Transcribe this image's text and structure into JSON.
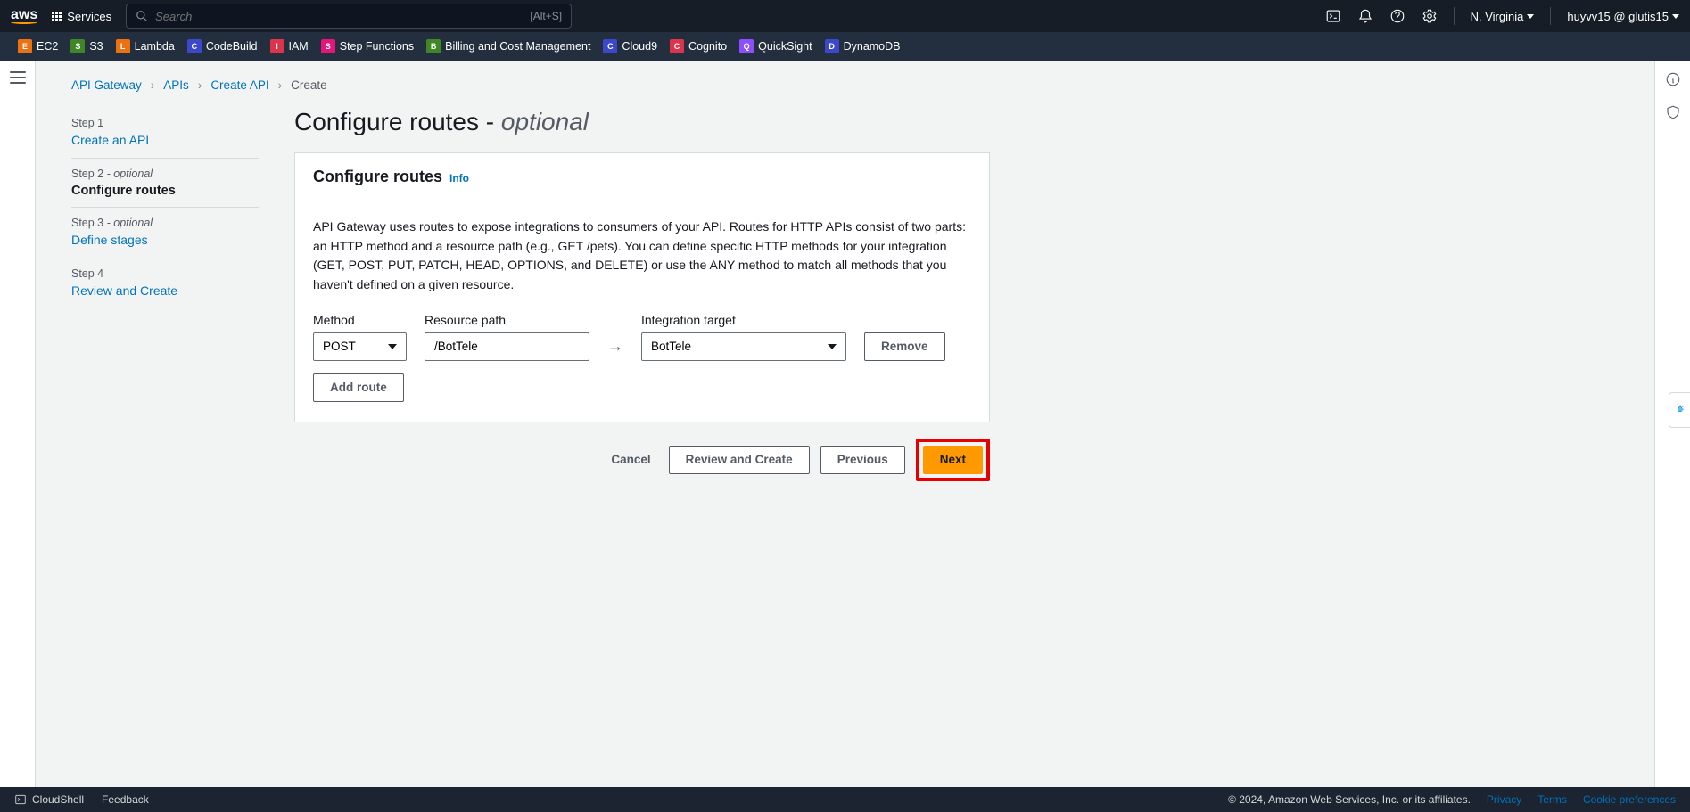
{
  "topbar": {
    "services_label": "Services",
    "search_placeholder": "Search",
    "search_shortcut": "[Alt+S]",
    "region": "N. Virginia",
    "account": "huyvv15 @ glutis15"
  },
  "service_shortcuts": [
    {
      "label": "EC2",
      "color": "#ec7211"
    },
    {
      "label": "S3",
      "color": "#3f8624"
    },
    {
      "label": "Lambda",
      "color": "#ec7211"
    },
    {
      "label": "CodeBuild",
      "color": "#3b48cc"
    },
    {
      "label": "IAM",
      "color": "#dd344c"
    },
    {
      "label": "Step Functions",
      "color": "#e7157b"
    },
    {
      "label": "Billing and Cost Management",
      "color": "#3f8624"
    },
    {
      "label": "Cloud9",
      "color": "#3b48cc"
    },
    {
      "label": "Cognito",
      "color": "#dd344c"
    },
    {
      "label": "QuickSight",
      "color": "#8c4fff"
    },
    {
      "label": "DynamoDB",
      "color": "#3b48cc"
    }
  ],
  "breadcrumb": {
    "items": [
      "API Gateway",
      "APIs",
      "Create API",
      "Create"
    ],
    "link_last_index": 2
  },
  "steps": [
    {
      "num": "Step 1",
      "optional": false,
      "title": "Create an API",
      "link": true,
      "current": false
    },
    {
      "num": "Step 2",
      "optional": true,
      "title": "Configure routes",
      "link": false,
      "current": true
    },
    {
      "num": "Step 3",
      "optional": true,
      "title": "Define stages",
      "link": true,
      "current": false
    },
    {
      "num": "Step 4",
      "optional": false,
      "title": "Review and Create",
      "link": true,
      "current": false
    }
  ],
  "page": {
    "title_main": "Configure routes",
    "title_dash": " - ",
    "title_opt": "optional"
  },
  "panel": {
    "heading": "Configure routes",
    "info": "Info",
    "description": "API Gateway uses routes to expose integrations to consumers of your API. Routes for HTTP APIs consist of two parts: an HTTP method and a resource path (e.g., GET /pets). You can define specific HTTP methods for your integration (GET, POST, PUT, PATCH, HEAD, OPTIONS, and DELETE) or use the ANY method to match all methods that you haven't defined on a given resource.",
    "labels": {
      "method": "Method",
      "path": "Resource path",
      "target": "Integration target"
    },
    "route": {
      "method": "POST",
      "path": "/BotTele",
      "target": "BotTele"
    },
    "remove_btn": "Remove",
    "add_btn": "Add route"
  },
  "actions": {
    "cancel": "Cancel",
    "review": "Review and Create",
    "previous": "Previous",
    "next": "Next"
  },
  "footer": {
    "cloudshell": "CloudShell",
    "feedback": "Feedback",
    "copyright": "© 2024, Amazon Web Services, Inc. or its affiliates.",
    "privacy": "Privacy",
    "terms": "Terms",
    "cookies": "Cookie preferences"
  }
}
